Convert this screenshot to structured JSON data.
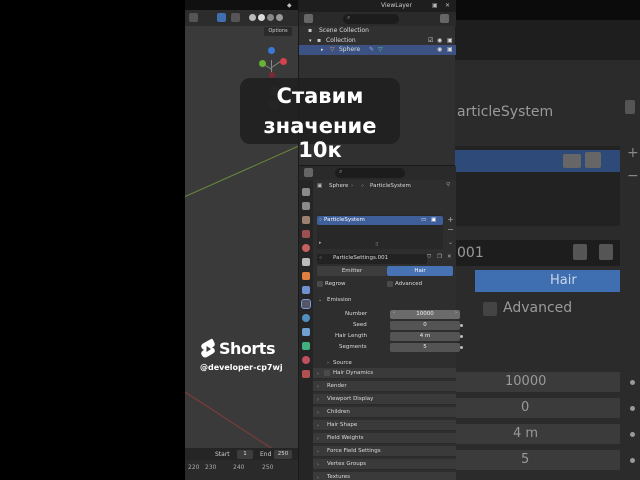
{
  "overlay": {
    "line1": "Ставим",
    "line2": "значение 10к"
  },
  "watermark": {
    "brand": "Shorts",
    "handle": "@developer-cp7wj"
  },
  "viewport": {
    "options_label": "Options"
  },
  "outliner": {
    "scene_label": "Scene",
    "viewlayer_label": "ViewLayer",
    "rows": [
      {
        "label": "Scene Collection"
      },
      {
        "label": "Collection"
      },
      {
        "label": "Sphere"
      }
    ]
  },
  "properties": {
    "breadcrumb_object": "Sphere",
    "breadcrumb_system": "ParticleSystem",
    "system_item": "ParticleSystem",
    "settings_name": "ParticleSettings.001",
    "tabs": {
      "emitter": "Emitter",
      "hair": "Hair"
    },
    "regrow_label": "Regrow",
    "advanced_label": "Advanced",
    "emission_label": "Emission",
    "fields": [
      {
        "label": "Number",
        "value": "10000"
      },
      {
        "label": "Seed",
        "value": "0"
      },
      {
        "label": "Hair Length",
        "value": "4 m"
      },
      {
        "label": "Segments",
        "value": "5"
      }
    ],
    "source_label": "Source",
    "panels": [
      "Hair Dynamics",
      "Render",
      "Viewport Display",
      "Children",
      "Hair Shape",
      "Field Weights",
      "Force Field Settings",
      "Vertex Groups",
      "Textures",
      "Custom Properties"
    ]
  },
  "timeline": {
    "start_label": "Start",
    "start_value": "1",
    "end_label": "End",
    "end_value": "250",
    "ticks": [
      "220",
      "230",
      "240",
      "250"
    ]
  },
  "backdrop": {
    "ps_text": "articleSystem",
    "name_text": "001",
    "hair_text": "Hair",
    "advanced_text": "Advanced",
    "values": [
      "10000",
      "0",
      "4 m",
      "5"
    ]
  },
  "colors": {
    "accent": "#3f6fb0",
    "selection": "#3b5282",
    "panel": "#303030"
  }
}
